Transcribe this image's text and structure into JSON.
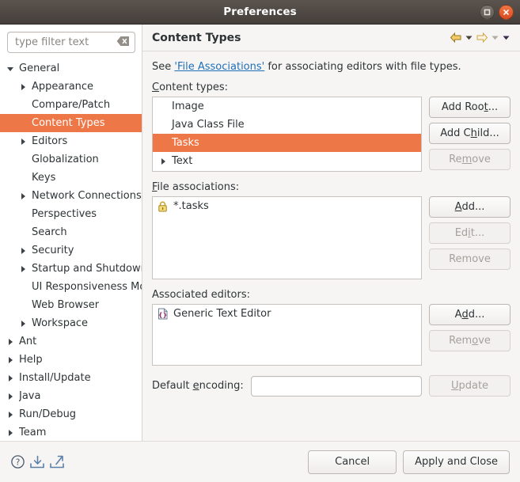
{
  "window": {
    "title": "Preferences",
    "maximize_icon": "maximize-icon",
    "close_icon": "close-icon"
  },
  "sidebar": {
    "filter": {
      "placeholder": "type filter text",
      "value": "",
      "clear_icon": "clear-icon"
    },
    "items": [
      {
        "label": "General",
        "indent": 0,
        "twisty": "expanded",
        "selected": false
      },
      {
        "label": "Appearance",
        "indent": 1,
        "twisty": "collapsed",
        "selected": false
      },
      {
        "label": "Compare/Patch",
        "indent": 1,
        "twisty": "none",
        "selected": false
      },
      {
        "label": "Content Types",
        "indent": 1,
        "twisty": "none",
        "selected": true
      },
      {
        "label": "Editors",
        "indent": 1,
        "twisty": "collapsed",
        "selected": false
      },
      {
        "label": "Globalization",
        "indent": 1,
        "twisty": "none",
        "selected": false
      },
      {
        "label": "Keys",
        "indent": 1,
        "twisty": "none",
        "selected": false
      },
      {
        "label": "Network Connections",
        "indent": 1,
        "twisty": "collapsed",
        "selected": false
      },
      {
        "label": "Perspectives",
        "indent": 1,
        "twisty": "none",
        "selected": false
      },
      {
        "label": "Search",
        "indent": 1,
        "twisty": "none",
        "selected": false
      },
      {
        "label": "Security",
        "indent": 1,
        "twisty": "collapsed",
        "selected": false
      },
      {
        "label": "Startup and Shutdown",
        "indent": 1,
        "twisty": "collapsed",
        "selected": false
      },
      {
        "label": "UI Responsiveness Monitoring",
        "indent": 1,
        "twisty": "none",
        "selected": false
      },
      {
        "label": "Web Browser",
        "indent": 1,
        "twisty": "none",
        "selected": false
      },
      {
        "label": "Workspace",
        "indent": 1,
        "twisty": "collapsed",
        "selected": false
      },
      {
        "label": "Ant",
        "indent": 0,
        "twisty": "collapsed",
        "selected": false
      },
      {
        "label": "Help",
        "indent": 0,
        "twisty": "collapsed",
        "selected": false
      },
      {
        "label": "Install/Update",
        "indent": 0,
        "twisty": "collapsed",
        "selected": false
      },
      {
        "label": "Java",
        "indent": 0,
        "twisty": "collapsed",
        "selected": false
      },
      {
        "label": "Run/Debug",
        "indent": 0,
        "twisty": "collapsed",
        "selected": false
      },
      {
        "label": "Team",
        "indent": 0,
        "twisty": "collapsed",
        "selected": false
      }
    ]
  },
  "content": {
    "title": "Content Types",
    "nav": {
      "back_icon": "back-arrow-icon",
      "back_menu_icon": "chevron-down-icon",
      "forward_icon": "forward-arrow-icon",
      "forward_menu_icon": "chevron-down-icon",
      "view_menu_icon": "chevron-down-icon"
    },
    "intro": {
      "prefix": "See ",
      "link": "'File Associations'",
      "suffix": " for associating editors with file types."
    },
    "content_types": {
      "label_pre": "C",
      "label_mnemonic": "C",
      "label": "Content types:",
      "items": [
        {
          "label": "Image",
          "twisty": "none",
          "selected": false
        },
        {
          "label": "Java Class File",
          "twisty": "none",
          "selected": false
        },
        {
          "label": "Tasks",
          "twisty": "none",
          "selected": true
        },
        {
          "label": "Text",
          "twisty": "collapsed",
          "selected": false
        }
      ],
      "buttons": [
        {
          "label": "Add Root...",
          "mnemonic": "t",
          "disabled": false
        },
        {
          "label": "Add Child...",
          "mnemonic": "h",
          "disabled": false
        },
        {
          "label": "Remove",
          "mnemonic": "m",
          "disabled": true
        }
      ]
    },
    "file_associations": {
      "label": "File associations:",
      "mnemonic": "F",
      "items": [
        {
          "label": "*.tasks",
          "icon": "lock-icon"
        }
      ],
      "buttons": [
        {
          "label": "Add...",
          "mnemonic": "A",
          "disabled": false
        },
        {
          "label": "Edit...",
          "mnemonic": "i",
          "disabled": true
        },
        {
          "label": "Remove",
          "mnemonic": "",
          "disabled": true
        }
      ]
    },
    "associated_editors": {
      "label": "Associated editors:",
      "mnemonic": "",
      "items": [
        {
          "label": "Generic Text Editor",
          "icon": "text-editor-icon"
        }
      ],
      "buttons": [
        {
          "label": "Add...",
          "mnemonic": "d",
          "disabled": false
        },
        {
          "label": "Remove",
          "mnemonic": "o",
          "disabled": true
        }
      ]
    },
    "default_encoding": {
      "label": "Default encoding:",
      "mnemonic": "e",
      "value": "",
      "placeholder": "",
      "update_button": {
        "label": "Update",
        "mnemonic": "U",
        "disabled": true
      }
    }
  },
  "footer": {
    "help_icon": "help-icon",
    "import_icon": "import-icon",
    "export_icon": "export-icon",
    "cancel_label": "Cancel",
    "apply_label": "Apply and Close"
  },
  "colors": {
    "selection": "#ed7747",
    "link": "#1d6fb8",
    "titlebar": "#4b4541",
    "close_button": "#e0502a"
  }
}
